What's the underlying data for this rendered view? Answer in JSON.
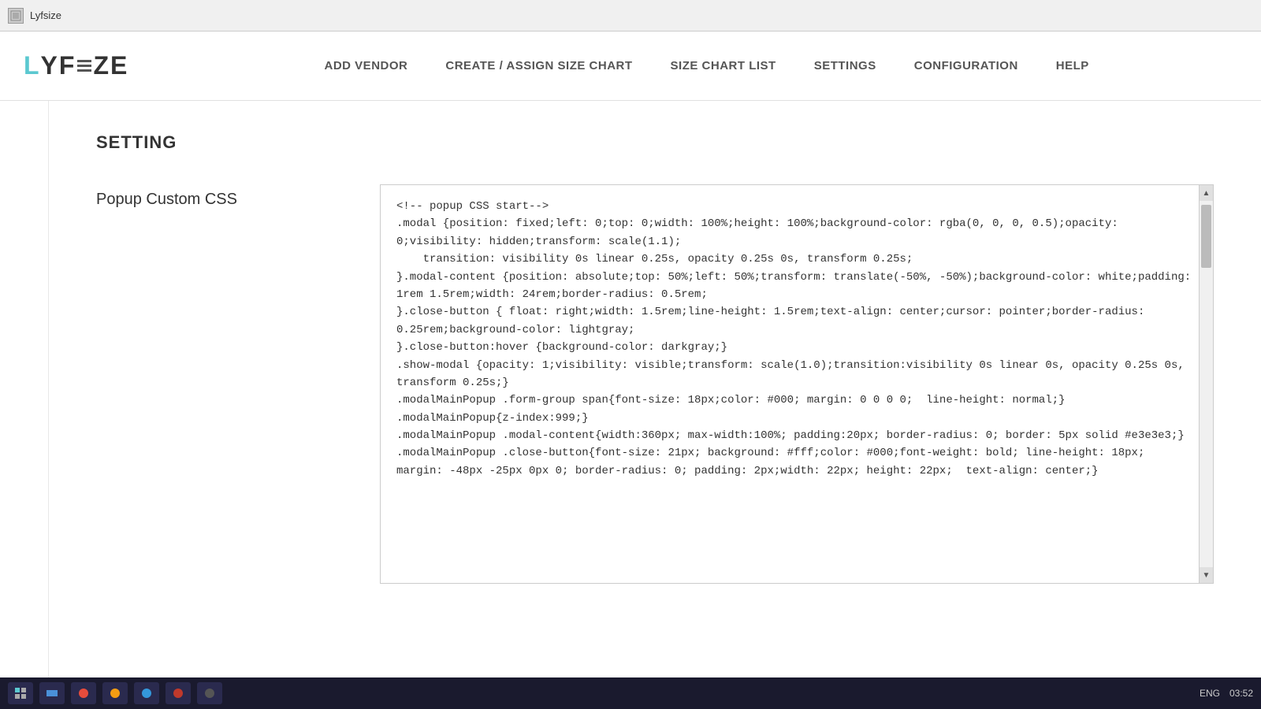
{
  "titlebar": {
    "app_name": "Lyfsize",
    "icon": "app-icon"
  },
  "navbar": {
    "logo": {
      "letters": [
        "L",
        "Y",
        "F",
        "S",
        "Z",
        "E"
      ]
    },
    "links": [
      {
        "label": "ADD VENDOR",
        "id": "add-vendor"
      },
      {
        "label": "CREATE / ASSIGN SIZE CHART",
        "id": "create-assign"
      },
      {
        "label": "SIZE CHART LIST",
        "id": "size-chart-list"
      },
      {
        "label": "SETTINGS",
        "id": "settings"
      },
      {
        "label": "CONFIGURATION",
        "id": "configuration"
      },
      {
        "label": "HELP",
        "id": "help"
      }
    ]
  },
  "main": {
    "section_title": "SETTING",
    "popup_css_label": "Popup Custom CSS",
    "css_content": "<!-- popup CSS start-->\n.modal {position: fixed;left: 0;top: 0;width: 100%;height: 100%;background-color: rgba(0, 0, 0, 0.5);opacity: 0;visibility: hidden;transform: scale(1.1);\n    transition: visibility 0s linear 0.25s, opacity 0.25s 0s, transform 0.25s;\n}.modal-content {position: absolute;top: 50%;left: 50%;transform: translate(-50%, -50%);background-color: white;padding: 1rem 1.5rem;width: 24rem;border-radius: 0.5rem;\n}.close-button { float: right;width: 1.5rem;line-height: 1.5rem;text-align: center;cursor: pointer;border-radius: 0.25rem;background-color: lightgray;\n}.close-button:hover {background-color: darkgray;}\n.show-modal {opacity: 1;visibility: visible;transform: scale(1.0);transition:visibility 0s linear 0s, opacity 0.25s 0s, transform 0.25s;}\n.modalMainPopup .form-group span{font-size: 18px;color: #000; margin: 0 0 0 0;  line-height: normal;}\n.modalMainPopup{z-index:999;}\n.modalMainPopup .modal-content{width:360px; max-width:100%; padding:20px; border-radius: 0; border: 5px solid #e3e3e3;}\n.modalMainPopup .close-button{font-size: 21px; background: #fff;color: #000;font-weight: bold; line-height: 18px; margin: -48px -25px 0px 0; border-radius: 0; padding: 2px;width: 22px; height: 22px;  text-align: center;}"
  },
  "taskbar": {
    "time": "03:52",
    "lang": "ENG"
  }
}
